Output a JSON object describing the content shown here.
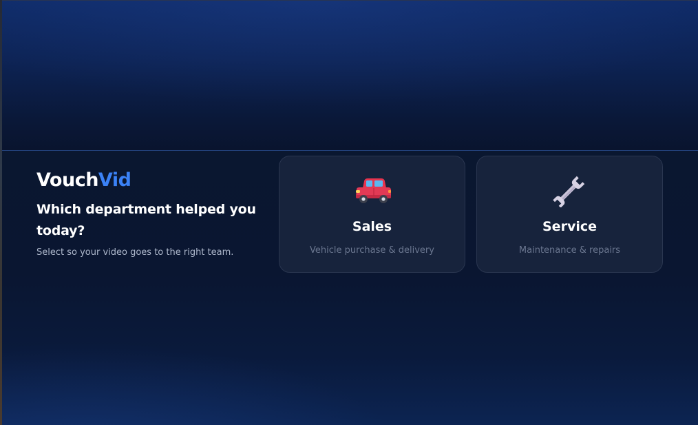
{
  "brand": {
    "name_part1": "Vouch",
    "name_part2": "Vid",
    "accent_color": "#3b82f6"
  },
  "prompt": {
    "question": "Which department helped you today?",
    "subtitle": "Select so your video goes to the right team."
  },
  "departments": [
    {
      "title": "Sales",
      "description": "Vehicle purchase & delivery",
      "icon": "car-icon"
    },
    {
      "title": "Service",
      "description": "Maintenance & repairs",
      "icon": "wrench-icon"
    }
  ]
}
